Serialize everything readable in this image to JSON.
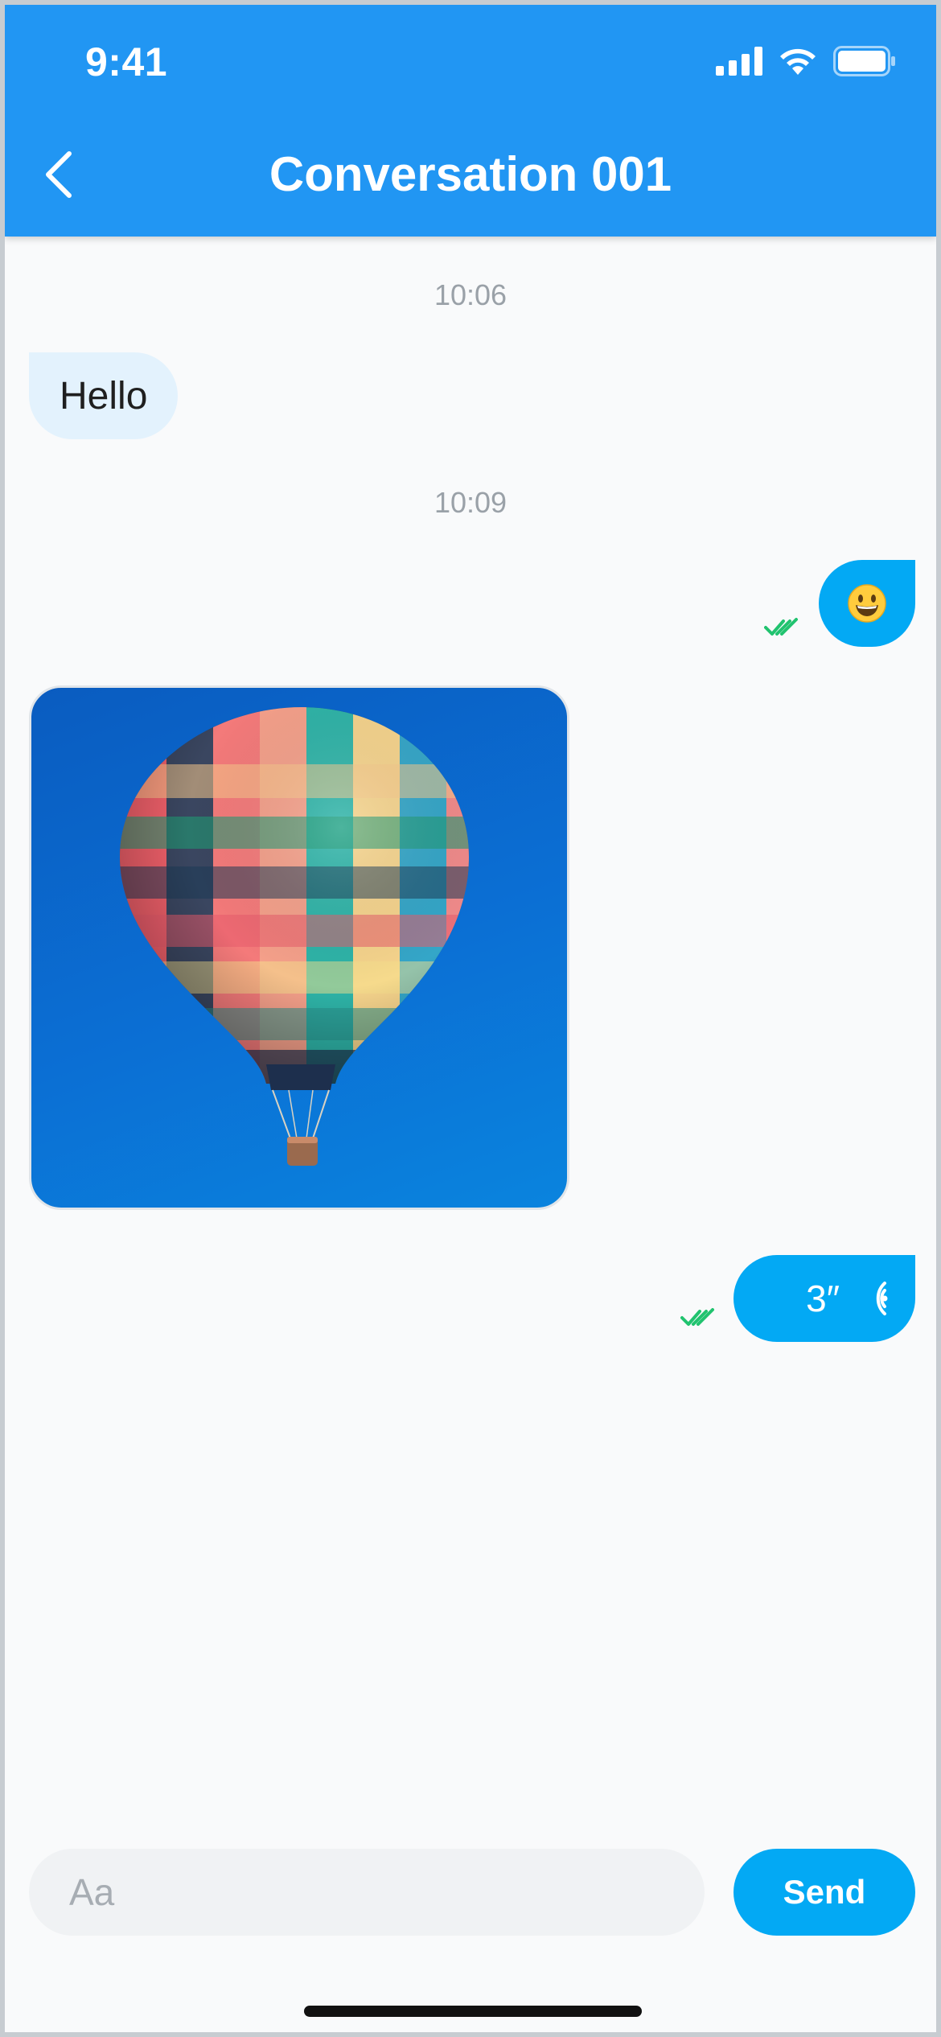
{
  "status_bar": {
    "time": "9:41",
    "icons": [
      "cellular-signal-icon",
      "wifi-icon",
      "battery-icon"
    ]
  },
  "header": {
    "title": "Conversation 001",
    "back_icon": "chevron-left-icon",
    "background": "#2196f3"
  },
  "messages": [
    {
      "type": "timestamp",
      "text": "10:06"
    },
    {
      "type": "text",
      "direction": "incoming",
      "text": "Hello"
    },
    {
      "type": "timestamp",
      "text": "10:09"
    },
    {
      "type": "emoji",
      "direction": "outgoing",
      "text": "😀",
      "status": "read"
    },
    {
      "type": "image",
      "direction": "incoming",
      "content": "hot air balloon photo"
    },
    {
      "type": "voice",
      "direction": "outgoing",
      "duration": "3″",
      "status": "read"
    }
  ],
  "composer": {
    "placeholder": "Aa",
    "value": "",
    "send_label": "Send"
  },
  "colors": {
    "incoming_bubble": "#e3f2fd",
    "outgoing_bubble": "#03a9f4",
    "read_check": "#21c36f",
    "background": "#f9fafb"
  }
}
